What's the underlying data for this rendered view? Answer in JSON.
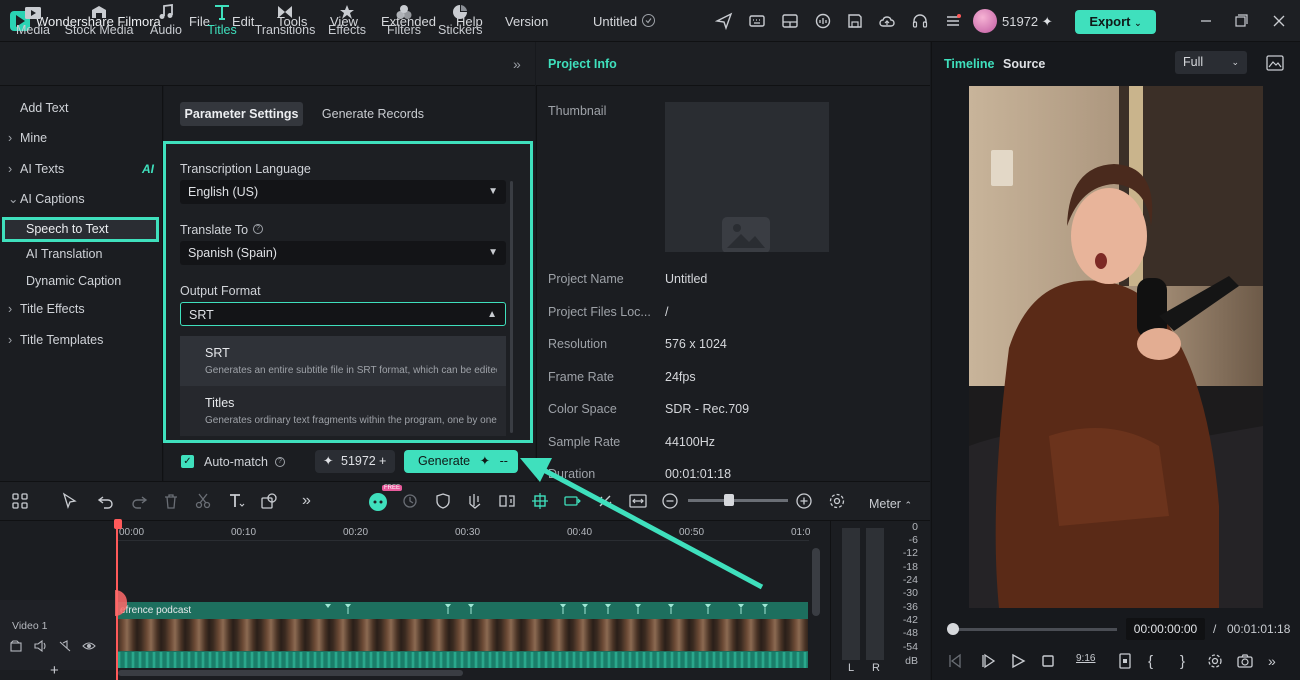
{
  "app": {
    "name": "Wondershare Filmora",
    "menu": [
      "File",
      "Edit",
      "Tools",
      "View",
      "Extended",
      "Help",
      "Version"
    ],
    "doc_title": "Untitled",
    "credits": "51972",
    "export_label": "Export"
  },
  "media_tabs": [
    {
      "label": "Media",
      "icon": "media-icon"
    },
    {
      "label": "Stock Media",
      "icon": "stock-media-icon"
    },
    {
      "label": "Audio",
      "icon": "music-note-icon"
    },
    {
      "label": "Titles",
      "icon": "titles-icon",
      "active": true
    },
    {
      "label": "Transitions",
      "icon": "transitions-icon"
    },
    {
      "label": "Effects",
      "icon": "effects-icon"
    },
    {
      "label": "Filters",
      "icon": "filters-icon"
    },
    {
      "label": "Stickers",
      "icon": "stickers-icon"
    }
  ],
  "left_nav": {
    "items": [
      "Add Text",
      "Mine",
      "AI Texts",
      "AI Captions",
      "Speech to Text",
      "AI Translation",
      "Dynamic Caption",
      "Title Effects",
      "Title Templates"
    ],
    "ai_badge": "AI",
    "selected": "Speech to Text"
  },
  "params": {
    "tab_active": "Parameter Settings",
    "tab_other": "Generate Records",
    "transcription_label": "Transcription Language",
    "transcription_value": "English (US)",
    "translate_label": "Translate To",
    "translate_value": "Spanish (Spain)",
    "output_label": "Output Format",
    "output_value": "SRT",
    "options": [
      {
        "title": "SRT",
        "desc": "Generates an entire subtitle file in SRT format, which can be edited"
      },
      {
        "title": "Titles",
        "desc": "Generates ordinary text fragments within the program, one by one"
      }
    ],
    "automatch_label": "Auto-match",
    "credits": "51972",
    "generate_label": "Generate",
    "generate_suffix": "--"
  },
  "project_info": {
    "heading": "Project Info",
    "thumbnail_label": "Thumbnail",
    "rows": [
      {
        "label": "Project Name",
        "value": "Untitled"
      },
      {
        "label": "Project Files Loc...",
        "value": "/"
      },
      {
        "label": "Resolution",
        "value": "576 x 1024"
      },
      {
        "label": "Frame Rate",
        "value": "24fps"
      },
      {
        "label": "Color Space",
        "value": "SDR - Rec.709"
      },
      {
        "label": "Sample Rate",
        "value": "44100Hz"
      },
      {
        "label": "Duration",
        "value": "00:01:01:18"
      }
    ]
  },
  "preview": {
    "tab_timeline": "Timeline",
    "tab_source": "Source",
    "zoom": "Full",
    "current_time": "00:00:00:00",
    "separator": "/",
    "total_time": "00:01:01:18"
  },
  "timeline": {
    "meter_label": "Meter",
    "ruler": [
      "00:00",
      "00:10",
      "00:20",
      "00:30",
      "00:40",
      "00:50",
      "01:0"
    ],
    "track_name": "Video 1",
    "clip_title": "efrence podcast",
    "db_scale": [
      "0",
      "-6",
      "-12",
      "-18",
      "-24",
      "-30",
      "-36",
      "-42",
      "-48",
      "-54",
      "dB"
    ],
    "meter_l": "L",
    "meter_r": "R",
    "free_badge": "FREE"
  },
  "colors": {
    "accent": "#3fe0bd",
    "playhead": "#ff5a5a"
  }
}
